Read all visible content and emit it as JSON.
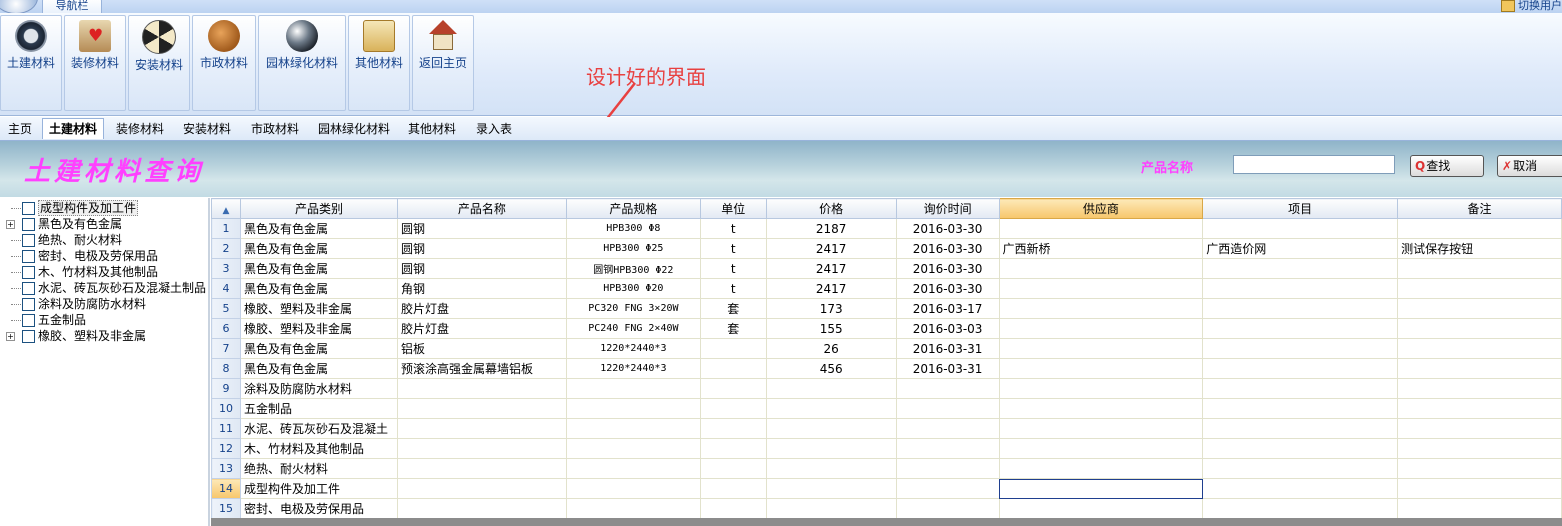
{
  "window": {
    "nav_tab": "导航栏",
    "top_right_text": "切换用户"
  },
  "ribbon": [
    {
      "label": "土建材料",
      "icon": "clock-icon"
    },
    {
      "label": "装修材料",
      "icon": "heart-folder-icon"
    },
    {
      "label": "安装材料",
      "icon": "radiation-icon"
    },
    {
      "label": "市政材料",
      "icon": "squirrel-icon"
    },
    {
      "label": "园林绿化材料",
      "icon": "globe-icon"
    },
    {
      "label": "其他材料",
      "icon": "tools-board-icon"
    },
    {
      "label": "返回主页",
      "icon": "home-icon"
    }
  ],
  "annotation": "设计好的界面",
  "tabs": [
    "主页",
    "土建材料",
    "装修材料",
    "安装材料",
    "市政材料",
    "园林绿化材料",
    "其他材料",
    "录入表"
  ],
  "active_tab": "土建材料",
  "query": {
    "title": "土建材料查询",
    "label": "产品名称",
    "input_value": "",
    "search_button": "查找",
    "cancel_button": "取消"
  },
  "tree": [
    {
      "label": "成型构件及加工件",
      "expandable": false,
      "selected": true
    },
    {
      "label": "黑色及有色金属",
      "expandable": true
    },
    {
      "label": "绝热、耐火材料",
      "expandable": false
    },
    {
      "label": "密封、电极及劳保用品",
      "expandable": false
    },
    {
      "label": "木、竹材料及其他制品",
      "expandable": false
    },
    {
      "label": "水泥、砖瓦灰砂石及混凝土制品",
      "expandable": false
    },
    {
      "label": "涂料及防腐防水材料",
      "expandable": false
    },
    {
      "label": "五金制品",
      "expandable": false
    },
    {
      "label": "橡胶、塑料及非金属",
      "expandable": true
    }
  ],
  "grid": {
    "columns": [
      "产品类别",
      "产品名称",
      "产品规格",
      "单位",
      "价格",
      "询价时间",
      "供应商",
      "项目",
      "备注"
    ],
    "highlight_column": "供应商",
    "current_row": "14",
    "rows": [
      {
        "n": "1",
        "cells": [
          "黑色及有色金属",
          "圆钢",
          "HPB300 Φ8",
          "t",
          "2187",
          "2016-03-30",
          "",
          "",
          ""
        ]
      },
      {
        "n": "2",
        "cells": [
          "黑色及有色金属",
          "圆钢",
          "HPB300 Φ25",
          "t",
          "2417",
          "2016-03-30",
          "广西新桥",
          "广西造价网",
          "测试保存按钮"
        ]
      },
      {
        "n": "3",
        "cells": [
          "黑色及有色金属",
          "圆钢",
          "圆钢HPB300 Φ22",
          "t",
          "2417",
          "2016-03-30",
          "",
          "",
          ""
        ]
      },
      {
        "n": "4",
        "cells": [
          "黑色及有色金属",
          "角钢",
          "HPB300 Φ20",
          "t",
          "2417",
          "2016-03-30",
          "",
          "",
          ""
        ]
      },
      {
        "n": "5",
        "cells": [
          "橡胶、塑料及非金属",
          "胶片灯盘",
          "PC320 FNG 3×20W",
          "套",
          "173",
          "2016-03-17",
          "",
          "",
          ""
        ]
      },
      {
        "n": "6",
        "cells": [
          "橡胶、塑料及非金属",
          "胶片灯盘",
          "PC240 FNG 2×40W",
          "套",
          "155",
          "2016-03-03",
          "",
          "",
          ""
        ]
      },
      {
        "n": "7",
        "cells": [
          "黑色及有色金属",
          "铝板",
          "1220*2440*3",
          "",
          "26",
          "2016-03-31",
          "",
          "",
          ""
        ]
      },
      {
        "n": "8",
        "cells": [
          "黑色及有色金属",
          "预滚涂高强金属幕墙铝板",
          "1220*2440*3",
          "",
          "456",
          "2016-03-31",
          "",
          "",
          ""
        ]
      },
      {
        "n": "9",
        "cells": [
          "涂料及防腐防水材料",
          "",
          "",
          "",
          "",
          "",
          "",
          "",
          ""
        ]
      },
      {
        "n": "10",
        "cells": [
          "五金制品",
          "",
          "",
          "",
          "",
          "",
          "",
          "",
          ""
        ]
      },
      {
        "n": "11",
        "cells": [
          "水泥、砖瓦灰砂石及混凝土",
          "",
          "",
          "",
          "",
          "",
          "",
          "",
          ""
        ]
      },
      {
        "n": "12",
        "cells": [
          "木、竹材料及其他制品",
          "",
          "",
          "",
          "",
          "",
          "",
          "",
          ""
        ]
      },
      {
        "n": "13",
        "cells": [
          "绝热、耐火材料",
          "",
          "",
          "",
          "",
          "",
          "",
          "",
          ""
        ]
      },
      {
        "n": "14",
        "cells": [
          "成型构件及加工件",
          "",
          "",
          "",
          "",
          "",
          "",
          "",
          ""
        ]
      },
      {
        "n": "15",
        "cells": [
          "密封、电极及劳保用品",
          "",
          "",
          "",
          "",
          "",
          "",
          "",
          ""
        ]
      }
    ]
  },
  "colors": {
    "accent": "#15428b",
    "title_pink": "#ff40ff",
    "annotation_red": "#e84040",
    "highlight": "#f7c66b"
  }
}
